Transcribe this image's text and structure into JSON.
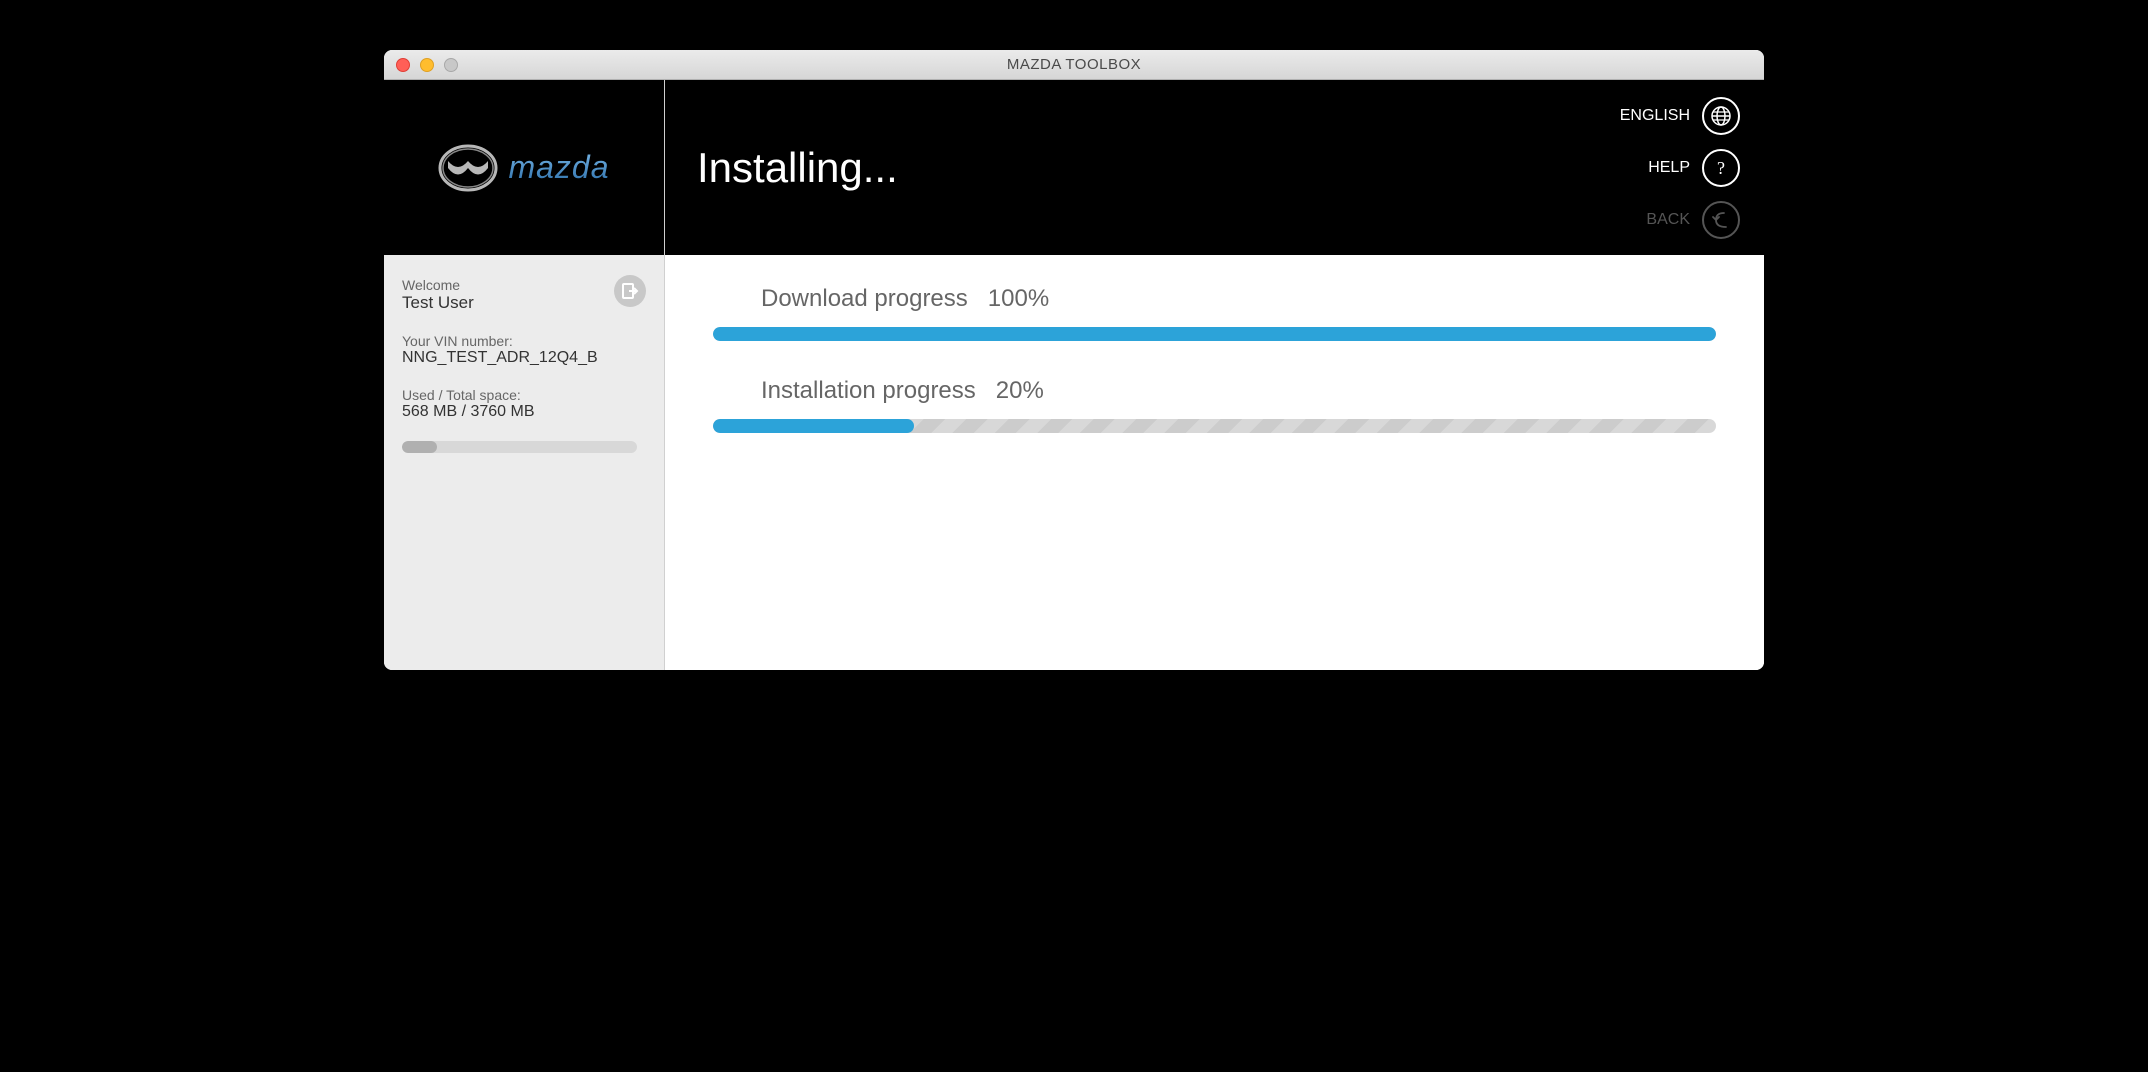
{
  "window": {
    "title": "MAZDA TOOLBOX"
  },
  "logo": {
    "brand": "mazda"
  },
  "sidebar": {
    "welcome_label": "Welcome",
    "user_name": "Test User",
    "vin_label": "Your VIN number:",
    "vin_value": "NNG_TEST_ADR_12Q4_B",
    "space_label": "Used / Total space:",
    "space_value": "568 MB / 3760 MB",
    "space_used_percent": 15
  },
  "header": {
    "page_title": "Installing...",
    "language_label": "ENGLISH",
    "help_label": "HELP",
    "back_label": "BACK"
  },
  "progress": {
    "download": {
      "label": "Download progress",
      "percent_text": "100%",
      "percent": 100
    },
    "installation": {
      "label": "Installation progress",
      "percent_text": "20%",
      "percent": 20
    }
  }
}
